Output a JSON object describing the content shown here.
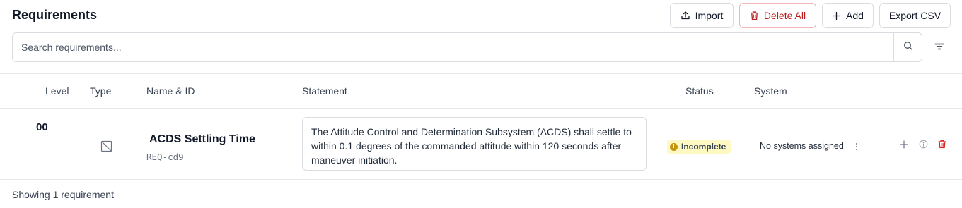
{
  "header": {
    "title": "Requirements"
  },
  "toolbar": {
    "import_label": "Import",
    "delete_all_label": "Delete All",
    "add_label": "Add",
    "export_label": "Export CSV"
  },
  "search": {
    "placeholder": "Search requirements..."
  },
  "table": {
    "columns": [
      "Level",
      "Type",
      "Name & ID",
      "Statement",
      "Status",
      "System"
    ],
    "rows": [
      {
        "level": "00",
        "type_icon": "box-slash-icon",
        "name": "ACDS Settling Time",
        "id": "REQ-cd9",
        "statement": "The Attitude Control and Determination Subsystem (ACDS) shall settle to within 0.1 degrees of the commanded attitude within 120 seconds after maneuver initiation.",
        "status": "Incomplete",
        "system": "No systems assigned"
      }
    ]
  },
  "footer": {
    "count_text": "Showing 1 requirement"
  },
  "colors": {
    "danger": "#b91c1c",
    "warning_bg": "#fef9c3",
    "warning_icon": "#c8920a",
    "border": "#d9dce1"
  }
}
